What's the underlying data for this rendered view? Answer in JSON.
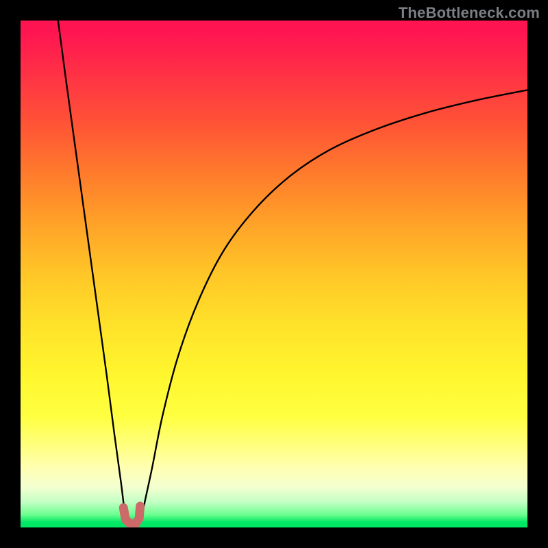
{
  "watermark": "TheBottleneck.com",
  "colors": {
    "frame": "#000000",
    "gradient_top": "#ff1452",
    "gradient_mid": "#ffe22a",
    "gradient_bottom": "#00e765",
    "curve": "#000000",
    "marker": "#cc6a6a",
    "watermark": "#7b7e83"
  },
  "chart_data": {
    "type": "line",
    "title": "",
    "xlabel": "",
    "ylabel": "",
    "xlim": [
      0,
      100
    ],
    "ylim": [
      0,
      100
    ],
    "axes_visible": false,
    "description": "Bottleneck-style curve overlaid on a vertical green-yellow-red gradient. The black curve descends sharply from the upper-left, reaches a sharp minimum near the bottom around x≈22, then rises asymptotically toward the upper-right. A thick salmon-colored U-shaped marker highlights the minimum region. Values approximate from plot area (0-100 each axis).",
    "series": [
      {
        "name": "left-descent",
        "x": [
          7.4,
          9,
          11,
          13,
          15,
          17,
          18.5,
          19.8,
          20.5,
          21
        ],
        "y": [
          100,
          88,
          73.5,
          59,
          44.5,
          30,
          18.5,
          9,
          3.5,
          1.5
        ]
      },
      {
        "name": "right-ascent",
        "x": [
          23.8,
          24.5,
          26,
          28,
          31,
          35,
          40,
          46,
          53,
          61,
          70,
          80,
          90,
          100
        ],
        "y": [
          1.5,
          5,
          12,
          22,
          33.5,
          44.5,
          54.5,
          62.5,
          69.2,
          74.5,
          78.5,
          81.8,
          84.3,
          86.3
        ]
      }
    ],
    "marker": {
      "name": "minimum-highlight",
      "x": [
        20.3,
        20.7,
        21.6,
        22.7,
        23.4,
        23.6
      ],
      "y": [
        3.9,
        1.6,
        0.7,
        0.7,
        1.8,
        4.2
      ]
    }
  }
}
